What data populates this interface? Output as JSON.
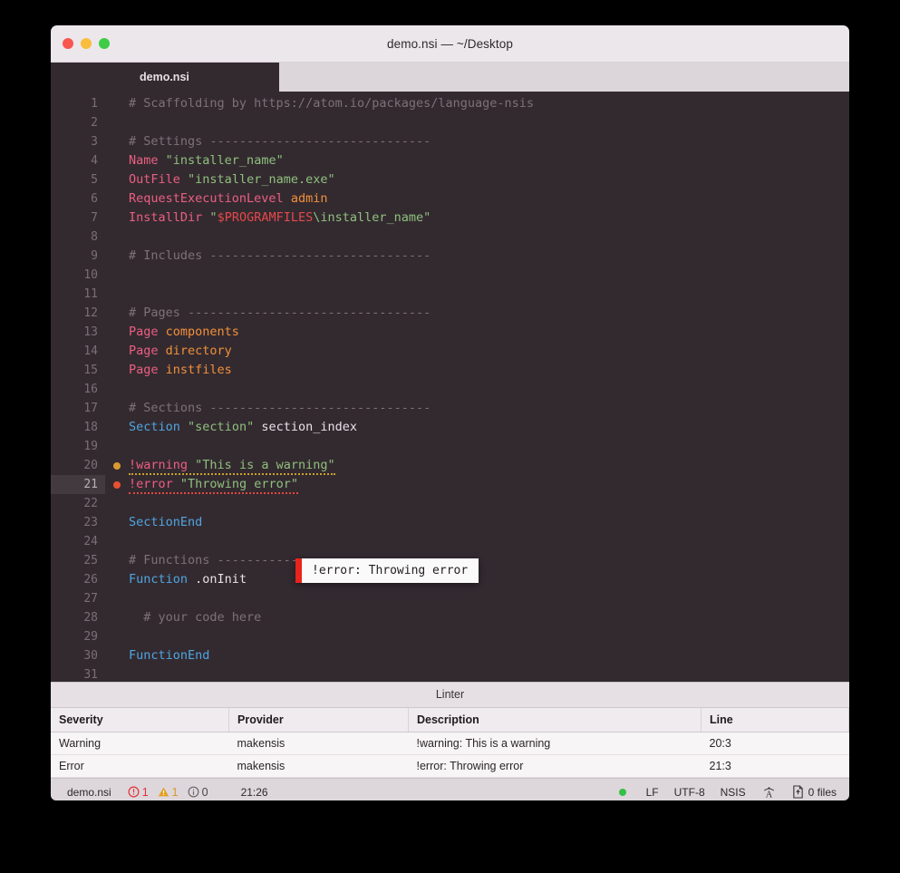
{
  "window": {
    "title": "demo.nsi — ~/Desktop",
    "traffic_lights": [
      "close-red",
      "minimize-yellow",
      "zoom-green"
    ]
  },
  "tabs": [
    {
      "label": "demo.nsi",
      "active": true
    }
  ],
  "editor": {
    "language": "NSIS",
    "active_line": 21,
    "lines": [
      {
        "n": "1",
        "tokens": [
          {
            "t": "# Scaffolding by https://atom.io/packages/language-nsis",
            "c": "c-comment"
          }
        ]
      },
      {
        "n": "2",
        "tokens": []
      },
      {
        "n": "3",
        "tokens": [
          {
            "t": "# Settings ------------------------------",
            "c": "c-comment"
          }
        ]
      },
      {
        "n": "4",
        "tokens": [
          {
            "t": "Name",
            "c": "c-key"
          },
          {
            "t": " ",
            "c": "c-plain"
          },
          {
            "t": "\"installer_name\"",
            "c": "c-string"
          }
        ]
      },
      {
        "n": "5",
        "tokens": [
          {
            "t": "OutFile",
            "c": "c-key"
          },
          {
            "t": " ",
            "c": "c-plain"
          },
          {
            "t": "\"installer_name.exe\"",
            "c": "c-string"
          }
        ]
      },
      {
        "n": "6",
        "tokens": [
          {
            "t": "RequestExecutionLevel",
            "c": "c-key"
          },
          {
            "t": " ",
            "c": "c-plain"
          },
          {
            "t": "admin",
            "c": "c-const"
          }
        ]
      },
      {
        "n": "7",
        "tokens": [
          {
            "t": "InstallDir",
            "c": "c-key"
          },
          {
            "t": " ",
            "c": "c-plain"
          },
          {
            "t": "\"",
            "c": "c-string"
          },
          {
            "t": "$PROGRAMFILES",
            "c": "c-var"
          },
          {
            "t": "\\installer_name\"",
            "c": "c-string"
          }
        ]
      },
      {
        "n": "8",
        "tokens": []
      },
      {
        "n": "9",
        "tokens": [
          {
            "t": "# Includes ------------------------------",
            "c": "c-comment"
          }
        ]
      },
      {
        "n": "10",
        "tokens": []
      },
      {
        "n": "11",
        "tokens": []
      },
      {
        "n": "12",
        "tokens": [
          {
            "t": "# Pages ---------------------------------",
            "c": "c-comment"
          }
        ]
      },
      {
        "n": "13",
        "tokens": [
          {
            "t": "Page",
            "c": "c-key"
          },
          {
            "t": " ",
            "c": "c-plain"
          },
          {
            "t": "components",
            "c": "c-const"
          }
        ]
      },
      {
        "n": "14",
        "tokens": [
          {
            "t": "Page",
            "c": "c-key"
          },
          {
            "t": " ",
            "c": "c-plain"
          },
          {
            "t": "directory",
            "c": "c-const"
          }
        ]
      },
      {
        "n": "15",
        "tokens": [
          {
            "t": "Page",
            "c": "c-key"
          },
          {
            "t": " ",
            "c": "c-plain"
          },
          {
            "t": "instfiles",
            "c": "c-const"
          }
        ]
      },
      {
        "n": "16",
        "tokens": []
      },
      {
        "n": "17",
        "tokens": [
          {
            "t": "# Sections ------------------------------",
            "c": "c-comment"
          }
        ]
      },
      {
        "n": "18",
        "tokens": [
          {
            "t": "Section",
            "c": "c-blue"
          },
          {
            "t": " ",
            "c": "c-plain"
          },
          {
            "t": "\"section\"",
            "c": "c-string"
          },
          {
            "t": " ",
            "c": "c-plain"
          },
          {
            "t": "section_index",
            "c": "c-white"
          }
        ]
      },
      {
        "n": "19",
        "tokens": []
      },
      {
        "n": "20",
        "marker": "warn",
        "indent": true,
        "underline": "sq-warn",
        "tokens": [
          {
            "t": "!warning",
            "c": "c-key"
          },
          {
            "t": " ",
            "c": "c-plain"
          },
          {
            "t": "\"This is a warning\"",
            "c": "c-string"
          }
        ]
      },
      {
        "n": "21",
        "marker": "err",
        "indent": true,
        "active": true,
        "underline": "sq-err",
        "tokens": [
          {
            "t": "!error",
            "c": "c-key"
          },
          {
            "t": " ",
            "c": "c-plain"
          },
          {
            "t": "\"Throwing error\"",
            "c": "c-string"
          }
        ]
      },
      {
        "n": "22",
        "tokens": []
      },
      {
        "n": "23",
        "tokens": [
          {
            "t": "SectionEnd",
            "c": "c-blue"
          }
        ]
      },
      {
        "n": "24",
        "tokens": []
      },
      {
        "n": "25",
        "tokens": [
          {
            "t": "# Functions -----------------------------",
            "c": "c-comment"
          }
        ]
      },
      {
        "n": "26",
        "tokens": [
          {
            "t": "Function",
            "c": "c-blue"
          },
          {
            "t": " ",
            "c": "c-plain"
          },
          {
            "t": ".onInit",
            "c": "c-white"
          }
        ]
      },
      {
        "n": "27",
        "tokens": []
      },
      {
        "n": "28",
        "tokens": [
          {
            "t": "  # your code here",
            "c": "c-comment"
          }
        ]
      },
      {
        "n": "29",
        "tokens": []
      },
      {
        "n": "30",
        "tokens": [
          {
            "t": "FunctionEnd",
            "c": "c-blue"
          }
        ]
      },
      {
        "n": "31",
        "tokens": []
      }
    ]
  },
  "tooltip": {
    "text": "!error: Throwing error",
    "accent_color": "#e8241c"
  },
  "linter": {
    "title": "Linter",
    "columns": [
      "Severity",
      "Provider",
      "Description",
      "Line"
    ],
    "rows": [
      {
        "severity": "Warning",
        "provider": "makensis",
        "description": "!warning: This is a warning",
        "line": "20:3"
      },
      {
        "severity": "Error",
        "provider": "makensis",
        "description": "!error: Throwing error",
        "line": "21:3"
      }
    ]
  },
  "statusbar": {
    "filename": "demo.nsi",
    "error_count": "1",
    "warning_count": "1",
    "info_count": "0",
    "cursor_position": "21:26",
    "git_status_color": "#35c046",
    "line_ending": "LF",
    "encoding": "UTF-8",
    "grammar": "NSIS",
    "spellcheck_icon": "spellcheck-icon",
    "files_label": "0 files"
  }
}
